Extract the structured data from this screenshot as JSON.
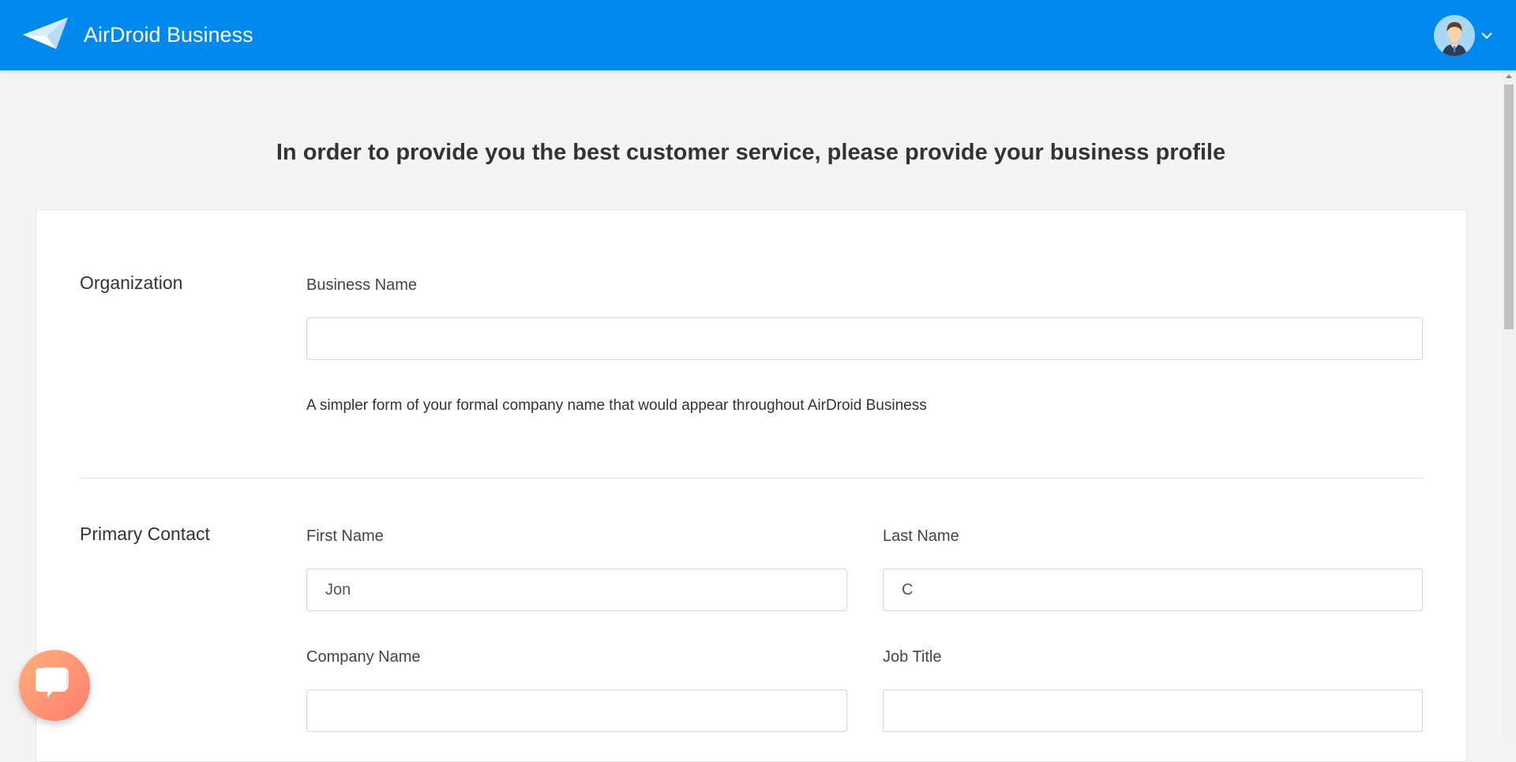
{
  "app": {
    "brand": "AirDroid Business"
  },
  "header": {
    "avatar_icon": "user-avatar-icon",
    "menu_icon": "chevron-down-icon"
  },
  "colors": {
    "topbar": "#0089ec",
    "page_bg": "#f4f4f4",
    "chat_gradient_start": "#ffb07a",
    "chat_gradient_end": "#ff7d6e"
  },
  "main": {
    "headline": "In order to provide you the best customer service, please provide your business profile",
    "organization": {
      "title": "Organization",
      "business_name_label": "Business Name",
      "business_name_value": "",
      "business_name_hint": "A simpler form of your formal company name that would appear throughout AirDroid Business"
    },
    "primary_contact": {
      "title": "Primary Contact",
      "first_name_label": "First Name",
      "first_name_value": "Jon",
      "last_name_label": "Last Name",
      "last_name_value": "C",
      "company_name_label": "Company Name",
      "company_name_value": "",
      "job_title_label": "Job Title",
      "job_title_value": ""
    }
  },
  "chat": {
    "icon": "chat-bubble-icon"
  }
}
